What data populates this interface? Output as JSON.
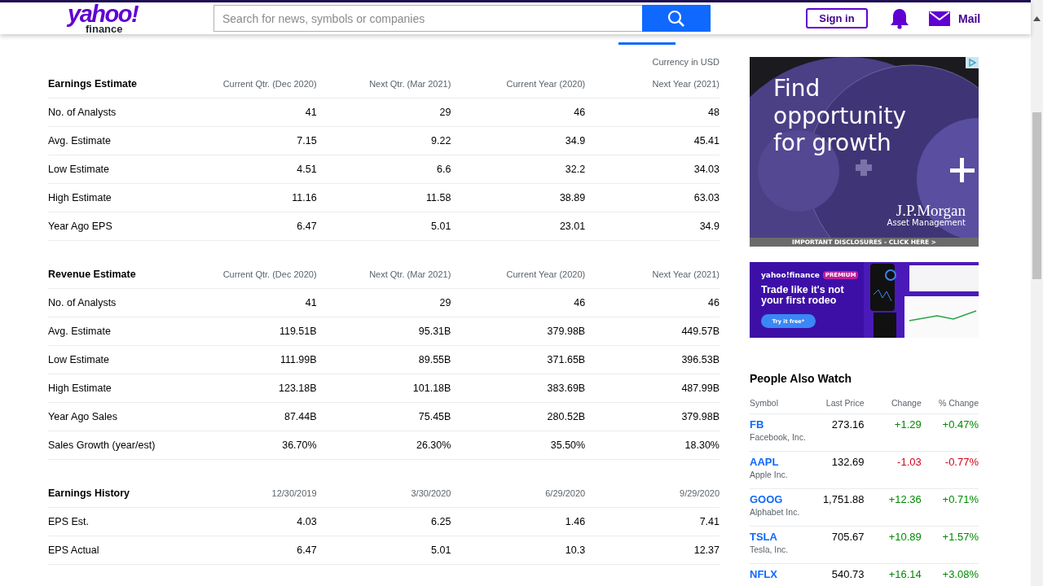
{
  "header": {
    "logo": {
      "brand": "yahoo!",
      "sub": "finance"
    },
    "search": {
      "placeholder": "Search for news, symbols or companies"
    },
    "sign_in": "Sign in",
    "mail": "Mail"
  },
  "currency_note": "Currency in USD",
  "tables": [
    {
      "title": "Earnings Estimate",
      "columns": [
        "Current Qtr. (Dec 2020)",
        "Next Qtr. (Mar 2021)",
        "Current Year (2020)",
        "Next Year (2021)"
      ],
      "rows": [
        {
          "label": "No. of Analysts",
          "values": [
            "41",
            "29",
            "46",
            "48"
          ]
        },
        {
          "label": "Avg. Estimate",
          "values": [
            "7.15",
            "9.22",
            "34.9",
            "45.41"
          ]
        },
        {
          "label": "Low Estimate",
          "values": [
            "4.51",
            "6.6",
            "32.2",
            "34.03"
          ]
        },
        {
          "label": "High Estimate",
          "values": [
            "11.16",
            "11.58",
            "38.89",
            "63.03"
          ]
        },
        {
          "label": "Year Ago EPS",
          "values": [
            "6.47",
            "5.01",
            "23.01",
            "34.9"
          ]
        }
      ]
    },
    {
      "title": "Revenue Estimate",
      "columns": [
        "Current Qtr. (Dec 2020)",
        "Next Qtr. (Mar 2021)",
        "Current Year (2020)",
        "Next Year (2021)"
      ],
      "rows": [
        {
          "label": "No. of Analysts",
          "values": [
            "41",
            "29",
            "46",
            "46"
          ]
        },
        {
          "label": "Avg. Estimate",
          "values": [
            "119.51B",
            "95.31B",
            "379.98B",
            "449.57B"
          ]
        },
        {
          "label": "Low Estimate",
          "values": [
            "111.99B",
            "89.55B",
            "371.65B",
            "396.53B"
          ]
        },
        {
          "label": "High Estimate",
          "values": [
            "123.18B",
            "101.18B",
            "383.69B",
            "487.99B"
          ]
        },
        {
          "label": "Year Ago Sales",
          "values": [
            "87.44B",
            "75.45B",
            "280.52B",
            "379.98B"
          ]
        },
        {
          "label": "Sales Growth (year/est)",
          "values": [
            "36.70%",
            "26.30%",
            "35.50%",
            "18.30%"
          ]
        }
      ]
    },
    {
      "title": "Earnings History",
      "columns": [
        "12/30/2019",
        "3/30/2020",
        "6/29/2020",
        "9/29/2020"
      ],
      "rows": [
        {
          "label": "EPS Est.",
          "values": [
            "4.03",
            "6.25",
            "1.46",
            "7.41"
          ]
        },
        {
          "label": "EPS Actual",
          "values": [
            "6.47",
            "5.01",
            "10.3",
            "12.37"
          ]
        }
      ]
    }
  ],
  "ads": [
    {
      "kind": "jpmorgan",
      "headline": "Find opportunity for growth",
      "brand": "J.P.Morgan",
      "brand_sub": "Asset Management",
      "disclosure": "IMPORTANT DISCLOSURES - CLICK HERE >"
    },
    {
      "kind": "premium",
      "brand": "yahoo!finance",
      "badge": "PREMIUM",
      "headline": "Trade like it's not your first rodeo",
      "button": "Try it free*"
    }
  ],
  "people_also_watch": {
    "title": "People Also Watch",
    "columns": [
      "Symbol",
      "Last Price",
      "Change",
      "% Change"
    ],
    "rows": [
      {
        "symbol": "FB",
        "name": "Facebook, Inc.",
        "price": "273.16",
        "change": "+1.29",
        "pct_change": "+0.47%",
        "color": "#008a00"
      },
      {
        "symbol": "AAPL",
        "name": "Apple Inc.",
        "price": "132.69",
        "change": "-1.03",
        "pct_change": "-0.77%",
        "color": "#d0021b"
      },
      {
        "symbol": "GOOG",
        "name": "Alphabet Inc.",
        "price": "1,751.88",
        "change": "+12.36",
        "pct_change": "+0.71%",
        "color": "#008a00"
      },
      {
        "symbol": "TSLA",
        "name": "Tesla, Inc.",
        "price": "705.67",
        "change": "+10.89",
        "pct_change": "+1.57%",
        "color": "#008a00"
      },
      {
        "symbol": "NFLX",
        "price": "540.73",
        "change": "+16.14",
        "pct_change": "+3.08%",
        "color": "#008a00"
      }
    ]
  }
}
